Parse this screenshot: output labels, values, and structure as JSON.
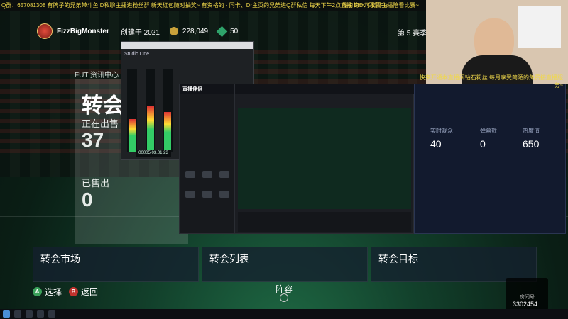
{
  "stream_overlay": {
    "ticker_text": "Q群：657081308 有牌子的兄弟带斗鱼ID私聊主播进粉丝群   新天红包随时抽奖~   有资格的 · 同卡、Dr主页的兄弟进Q群私信   每天下午2点直播   BID：菲菲Fiz",
    "ticker_right": "周榜第一可安排主播陪看比赛~",
    "promo_text": "快来开通本直播间钻石粉丝 每月享受简陋的免费接直播服务~"
  },
  "profile": {
    "name": "FizzBigMonster",
    "created": "创建于 2021",
    "coins": "228,049",
    "points": "50"
  },
  "season_label": "第 5 赛季",
  "fut_label": "FUT 资讯中心",
  "transfer_panel": {
    "title": "转会",
    "selling_label": "正在出售",
    "selling_value": "37",
    "sold_label": "已售出",
    "sold_value": "0"
  },
  "cards": [
    {
      "label": "转会市场"
    },
    {
      "label": "转会列表"
    },
    {
      "label": "转会目标"
    }
  ],
  "hints": {
    "select_button": "A",
    "select_label": "选择",
    "back_button": "B",
    "back_label": "返回",
    "lineup_label": "阵容"
  },
  "obs": {
    "title": "Studio One",
    "timecode": "00005.03.01.23"
  },
  "douyu": {
    "logo": "直播伴侣"
  },
  "analytics": {
    "stat1_label": "实时观众",
    "stat1_value": "40",
    "stat2_label": "弹幕数",
    "stat2_value": "0",
    "stat3_label": "热度值",
    "stat3_value": "650"
  },
  "watermark": {
    "label": "房间号",
    "number": "3302454"
  },
  "colors": {
    "accent_yellow": "#f0d84a",
    "select_button_color": "#3aa05a",
    "back_button_color": "#c0332e"
  }
}
